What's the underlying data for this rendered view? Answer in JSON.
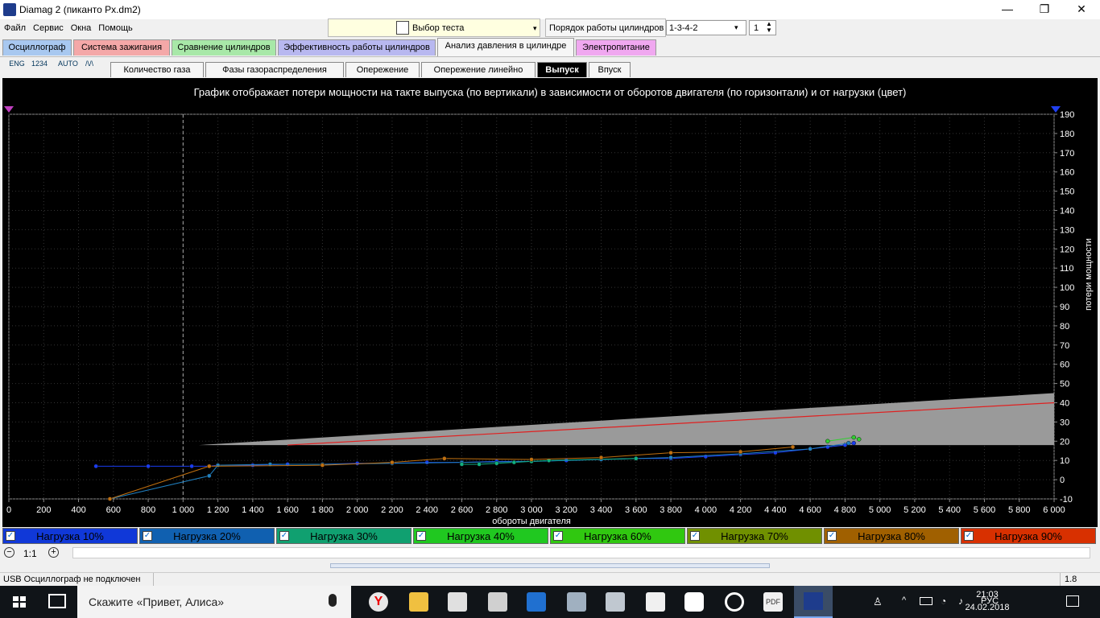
{
  "window": {
    "title": "Diamag 2 (пиканто Px.dm2)",
    "minimize": "—",
    "maximize": "❐",
    "close": "✕"
  },
  "menu": [
    "Файл",
    "Сервис",
    "Окна",
    "Помощь"
  ],
  "toolbar": {
    "test_select": "Выбор теста",
    "order_label": "Порядок работы цилиндров",
    "order_value": "1-3-4-2",
    "cylinder_value": "1"
  },
  "main_tabs": [
    {
      "label": "Осциллограф",
      "color": "#a8c8f0"
    },
    {
      "label": "Система зажигания",
      "color": "#f4a8a8"
    },
    {
      "label": "Сравнение цилиндров",
      "color": "#a8e8a8"
    },
    {
      "label": "Эффективность работы цилиндров",
      "color": "#b8b8f0"
    },
    {
      "label": "Анализ давления в цилиндре",
      "color": "#f6f6f6"
    },
    {
      "label": "Электропитание",
      "color": "#f0a8f0"
    }
  ],
  "tools": [
    "ENG",
    "1234",
    "AUTO",
    "/\\/\\"
  ],
  "sub_tabs": [
    "Количество газа",
    "Фазы газораспределения",
    "Опережение",
    "Опережение линейно",
    "Выпуск",
    "Впуск"
  ],
  "legend": [
    {
      "label": "Нагрузка 10%",
      "color": "#1038d8"
    },
    {
      "label": "Нагрузка 20%",
      "color": "#1060b0"
    },
    {
      "label": "Нагрузка 30%",
      "color": "#10a070"
    },
    {
      "label": "Нагрузка 40%",
      "color": "#20c820"
    },
    {
      "label": "Нагрузка 60%",
      "color": "#30c810"
    },
    {
      "label": "Нагрузка 70%",
      "color": "#709000"
    },
    {
      "label": "Нагрузка 80%",
      "color": "#a06000"
    },
    {
      "label": "Нагрузка 90%",
      "color": "#d83000"
    }
  ],
  "zoom": {
    "label": "1:1"
  },
  "status": {
    "text": "USB Осциллограф не подключен",
    "version": "1.8"
  },
  "taskbar": {
    "search_text": "Скажите «Привет, Алиса»",
    "lang": "РУС",
    "time": "21:03",
    "date": "24.02.2018"
  },
  "chart_data": {
    "type": "scatter",
    "title": "График отображает потери мощности на такте выпуска (по вертикали) в зависимости от оборотов двигателя (по горизонтали) и от нагрузки (цвет)",
    "xlabel": "обороты двигателя",
    "ylabel": "потери мощности",
    "xlim": [
      0,
      6000
    ],
    "ylim": [
      -10,
      190
    ],
    "x_ticks": [
      "0",
      "200",
      "400",
      "600",
      "800",
      "1 000",
      "1 200",
      "1 400",
      "1 600",
      "1 800",
      "2 000",
      "2 200",
      "2 400",
      "2 600",
      "2 800",
      "3 000",
      "3 200",
      "3 400",
      "3 600",
      "3 800",
      "4 000",
      "4 200",
      "4 400",
      "4 600",
      "4 800",
      "5 000",
      "5 200",
      "5 400",
      "5 600",
      "5 800",
      "6 000"
    ],
    "y_ticks": [
      "190",
      "180",
      "170",
      "160",
      "150",
      "140",
      "130",
      "120",
      "110",
      "100",
      "90",
      "80",
      "70",
      "60",
      "50",
      "40",
      "30",
      "20",
      "10",
      "0",
      "-10"
    ],
    "grid": true,
    "marker_x": 1000,
    "band": {
      "x": [
        1090,
        6000
      ],
      "lower": [
        18,
        18
      ],
      "upper": [
        18,
        45
      ]
    },
    "red_line": {
      "x": [
        1600,
        6000
      ],
      "y": [
        18,
        40
      ]
    },
    "series": [
      {
        "name": "Нагрузка 10%",
        "color": "#1a3cf0",
        "x": [
          500,
          800,
          1050,
          1150,
          1200,
          1400,
          1600,
          1800,
          2000,
          2200,
          2400,
          2600,
          2800,
          3000,
          3200,
          3400,
          3600,
          3800,
          4000,
          4200,
          4400,
          4600,
          4700,
          4800,
          4850
        ],
        "y": [
          7,
          7,
          7,
          7,
          7.5,
          7.5,
          8,
          8,
          8.5,
          8.5,
          9,
          9,
          9.5,
          9.5,
          10,
          10.5,
          11,
          11,
          12,
          13,
          14,
          16,
          17,
          18,
          19
        ]
      },
      {
        "name": "Нагрузка 20%",
        "color": "#2080c0",
        "x": [
          580,
          1150,
          1200,
          1500,
          1800,
          2200,
          2600,
          3000,
          3400,
          3800,
          4200,
          4600,
          4820
        ],
        "y": [
          -10,
          2,
          7.5,
          8,
          8,
          8.5,
          9,
          9.5,
          10.5,
          11.5,
          13.5,
          16,
          19
        ]
      },
      {
        "name": "Нагрузка 30%",
        "color": "#10b080",
        "x": [
          2600,
          2700,
          2800,
          2900,
          3000,
          3100,
          3600
        ],
        "y": [
          8,
          8,
          8.5,
          9,
          9.5,
          10,
          11
        ]
      },
      {
        "name": "Нагрузка 40%",
        "color": "#30d030",
        "x": [
          4700,
          4850,
          4880
        ],
        "y": [
          20,
          22,
          21
        ]
      },
      {
        "name": "Нагрузка 80%",
        "color": "#c07010",
        "x": [
          580,
          1150,
          1800,
          2200,
          2500,
          3000,
          3400,
          3800,
          4200,
          4500
        ],
        "y": [
          -10,
          7,
          7.5,
          9,
          11,
          10.5,
          11.5,
          14,
          14.5,
          17
        ]
      }
    ]
  }
}
